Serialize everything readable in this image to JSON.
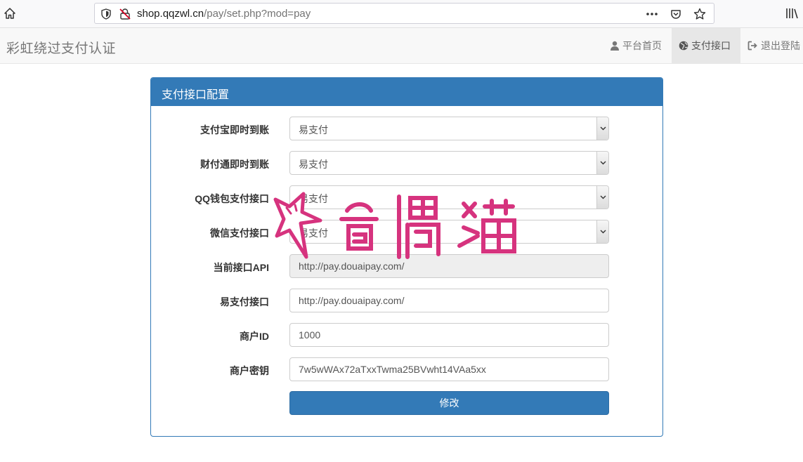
{
  "browser": {
    "url_host": "shop.qqzwl.cn",
    "url_path": "/pay/set.php?mod=pay",
    "page_actions_icon": "more-horizontal-icon",
    "pocket_icon": "pocket-icon",
    "bookmark_icon": "star-icon"
  },
  "navbar": {
    "brand": "彩虹绕过支付认证",
    "items": [
      {
        "label": "平台首页",
        "icon": "user-icon",
        "active": false
      },
      {
        "label": "支付接口",
        "icon": "globe-icon",
        "active": true
      },
      {
        "label": "退出登陆",
        "icon": "logout-icon",
        "active": false
      }
    ]
  },
  "panel": {
    "title": "支付接口配置",
    "fields": [
      {
        "label": "支付宝即时到账",
        "value": "易支付",
        "type": "select"
      },
      {
        "label": "财付通即时到账",
        "value": "易支付",
        "type": "select"
      },
      {
        "label": "QQ钱包支付接口",
        "value": "易支付",
        "type": "select"
      },
      {
        "label": "微信支付接口",
        "value": "易支付",
        "type": "select"
      },
      {
        "label": "当前接口API",
        "value": "http://pay.douaipay.com/",
        "type": "readonly"
      },
      {
        "label": "易支付接口",
        "value": "http://pay.douaipay.com/",
        "type": "text"
      },
      {
        "label": "商户ID",
        "value": "1000",
        "type": "text"
      },
      {
        "label": "商户密钥",
        "value": "7w5wWAx72aTxxTwma25BVwht14VAa5xx",
        "type": "text"
      }
    ],
    "submit_label": "修改"
  },
  "watermark": {
    "text": "奇偶猫",
    "color": "#d6337e"
  }
}
